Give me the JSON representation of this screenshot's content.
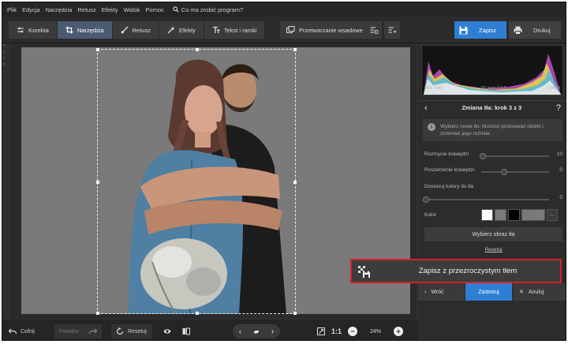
{
  "menu": [
    "Plik",
    "Edycja",
    "Narzędzia",
    "Retusz",
    "Efekty",
    "Widok",
    "Pomoc"
  ],
  "search": {
    "placeholder": "Co ma zrobić program?"
  },
  "toolbar": {
    "tabs": [
      {
        "label": "Korekta",
        "icon": "sliders-icon"
      },
      {
        "label": "Narzędzia",
        "icon": "crop-icon",
        "active": true
      },
      {
        "label": "Retusz",
        "icon": "brush-icon"
      },
      {
        "label": "Efekty",
        "icon": "magic-wand-icon"
      },
      {
        "label": "Tekst i ramki",
        "icon": "text-icon"
      }
    ],
    "batch_label": "Przetwarzanie wsadowe",
    "save_label": "Zapisz",
    "print_label": "Drukuj"
  },
  "histogram": {
    "iso": "ISO 100",
    "lens": "55 mm f/3.5",
    "shutter": "1/1000"
  },
  "step": {
    "title": "Zmiana tła: krok 3 z 3",
    "help": "?"
  },
  "info_text": "Wybierz nowe tło. Możesz przesuwać obiekt i zmieniać jego rozmiar.",
  "controls": {
    "blur_label": "Rozmycie krawędzi",
    "blur_value": "10",
    "expand_label": "Poszerzenie krawędzi",
    "expand_value": "0",
    "adjust_label": "Dostosuj kolory do tła",
    "adjust_value": "0",
    "color_label": "Kolor",
    "swatches": [
      "#ffffff",
      "#7a7a7a",
      "#000000",
      "#7a7a7a"
    ],
    "more_label": "...",
    "choose_image_label": "Wybierz obraz tła",
    "reset_link": "Resetuj"
  },
  "overlay_button": {
    "label": "Zapisz z przezroczystym tłem"
  },
  "panel_buttons": {
    "back": "Wróć",
    "apply": "Zastosuj",
    "cancel": "Anuluj"
  },
  "statusbar": {
    "undo": "Cofnij",
    "redo": "Powtórz",
    "reset": "Resetuj",
    "ratio": "1:1",
    "zoom": "24%"
  },
  "colors": {
    "accent": "#2e7fd4",
    "highlight": "#d3222a",
    "canvas": "#7a7a7a"
  }
}
